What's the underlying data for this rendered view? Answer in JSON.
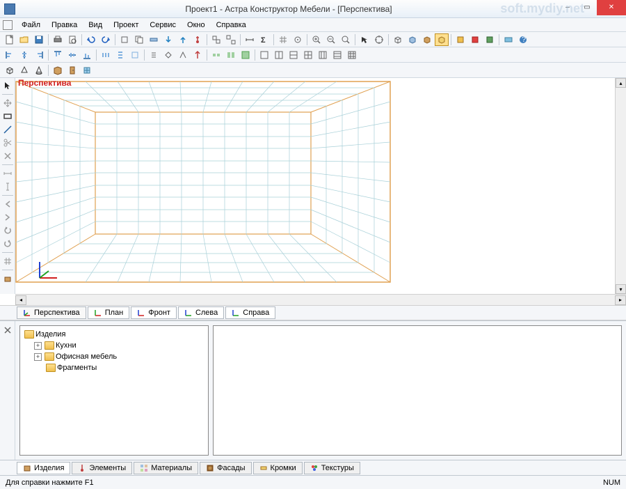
{
  "title": "Проект1 - Астра Конструктор Мебели - [Перспектива]",
  "watermark": "soft.mydiy.net",
  "menu": {
    "items": [
      "Файл",
      "Правка",
      "Вид",
      "Проект",
      "Сервис",
      "Окно",
      "Справка"
    ]
  },
  "viewport": {
    "label": "Перспектива"
  },
  "viewtabs": {
    "items": [
      "Перспектива",
      "План",
      "Фронт",
      "Слева",
      "Справа"
    ],
    "active": 0
  },
  "tree": {
    "root": "Изделия",
    "children": [
      {
        "label": "Кухни",
        "expandable": true
      },
      {
        "label": "Офисная мебель",
        "expandable": true
      },
      {
        "label": "Фрагменты",
        "expandable": false
      }
    ]
  },
  "bottom_tabs": {
    "items": [
      "Изделия",
      "Элементы",
      "Материалы",
      "Фасады",
      "Кромки",
      "Текстуры"
    ],
    "active": 0
  },
  "status": {
    "help": "Для справки нажмите F1",
    "num": "NUM"
  },
  "colors": {
    "grid": "#a8d0d8",
    "outline": "#e0a050",
    "label": "#d02020"
  }
}
